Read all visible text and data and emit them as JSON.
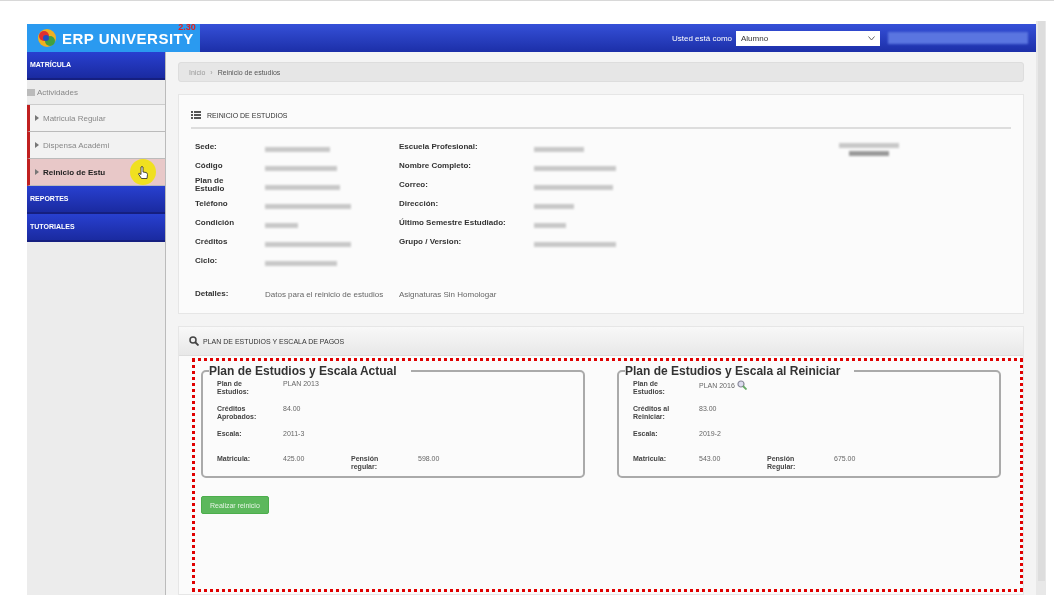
{
  "header": {
    "logo_text": "ERP UNIVERSITY",
    "version": "2.30",
    "role_label": "Usted está como",
    "role_select": {
      "value": "Alumno"
    },
    "user_blurred": true
  },
  "sidebar": {
    "sections": [
      {
        "label": "MATRÍCULA",
        "group": "Actividades",
        "items": [
          {
            "label": "Matricula Regular",
            "selected": false
          },
          {
            "label": "Dispensa Académi",
            "selected": false
          },
          {
            "label": "Reinicio de Estu",
            "selected": true
          }
        ]
      },
      {
        "label": "REPORTES"
      },
      {
        "label": "TUTORIALES"
      }
    ]
  },
  "breadcrumb": {
    "separator": "›",
    "items": [
      "Inicio",
      "Reinicio de estudios"
    ]
  },
  "student_panel": {
    "title": "REINICIO DE ESTUDIOS",
    "fields_left": [
      {
        "label": "Sede:",
        "blurred": true
      },
      {
        "label": "Código",
        "blurred": true
      },
      {
        "label": "Plan de Estudio",
        "blurred": true
      },
      {
        "label": "Teléfono",
        "blurred": true
      },
      {
        "label": "Condición",
        "blurred": true
      },
      {
        "label": "Créditos",
        "blurred": true
      },
      {
        "label": "Ciclo:",
        "blurred": true
      }
    ],
    "fields_right": [
      {
        "label": "Escuela Profesional:",
        "blurred": true
      },
      {
        "label": "Nombre Completo:",
        "blurred": true
      },
      {
        "label": "Correo:",
        "blurred": true
      },
      {
        "label": "Dirección:",
        "blurred": true
      },
      {
        "label": "Último Semestre Estudiado:",
        "blurred": true
      },
      {
        "label": "Grupo / Version:",
        "blurred": true
      }
    ],
    "photo_caption_blurred": true,
    "details": {
      "label": "Detalles:",
      "text": "Datos para el reinicio de estudios",
      "link": "Asignaturas Sin Homologar"
    }
  },
  "plan_panel": {
    "title": "PLAN DE ESTUDIOS Y ESCALA DE PAGOS",
    "fieldsets": [
      {
        "legend": "Plan de Estudios y Escala Actual",
        "rows": [
          [
            {
              "label": "Plan de Estudios:",
              "value": "PLAN 2013",
              "search_icon": false
            }
          ],
          [
            {
              "label": "Créditos Aprobados:",
              "value": "84.00"
            }
          ],
          [
            {
              "label": "Escala:",
              "value": "2011-3"
            }
          ],
          [
            {
              "label": "Matricula:",
              "value": "425.00"
            },
            {
              "label": "Pensión regular:",
              "value": "598.00"
            }
          ]
        ]
      },
      {
        "legend": "Plan de Estudios y Escala al Reiniciar",
        "rows": [
          [
            {
              "label": "Plan de Estudios:",
              "value": "PLAN 2016",
              "search_icon": true
            }
          ],
          [
            {
              "label": "Créditos al Reiniciar:",
              "value": "83.00"
            }
          ],
          [
            {
              "label": "Escala:",
              "value": "2019-2"
            }
          ],
          [
            {
              "label": "Matricula:",
              "value": "543.00"
            },
            {
              "label": "Pensión Regular:",
              "value": "675.00"
            }
          ]
        ]
      }
    ],
    "button": "Realizar reinicio"
  },
  "annotation": {
    "highlight_plan": true
  },
  "cursor_highlight": true
}
